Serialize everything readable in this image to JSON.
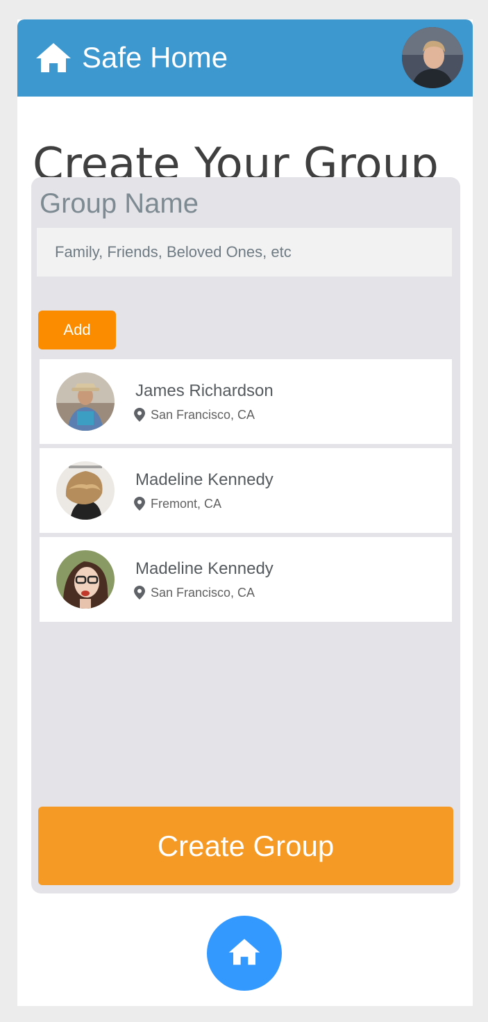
{
  "header": {
    "app_title": "Safe Home",
    "home_icon": "home-icon",
    "profile_avatar": "profile-avatar"
  },
  "page": {
    "title": "Create Your Group"
  },
  "form": {
    "group_name_label": "Group Name",
    "group_name_placeholder": "Family, Friends, Beloved Ones, etc",
    "group_name_value": "",
    "add_label": "Add"
  },
  "members": [
    {
      "name": "James Richardson",
      "location": "San Francisco, CA"
    },
    {
      "name": "Madeline Kennedy",
      "location": "Fremont, CA"
    },
    {
      "name": "Madeline Kennedy",
      "location": "San Francisco, CA"
    }
  ],
  "actions": {
    "create_label": "Create Group"
  },
  "colors": {
    "header": "#3e98d0",
    "accent_orange": "#fb8c00",
    "create_button": "#f59a25",
    "fab": "#3399ff",
    "panel": "#e4e3e8"
  },
  "icons": {
    "location": "map-pin-icon",
    "fab": "home-icon"
  }
}
